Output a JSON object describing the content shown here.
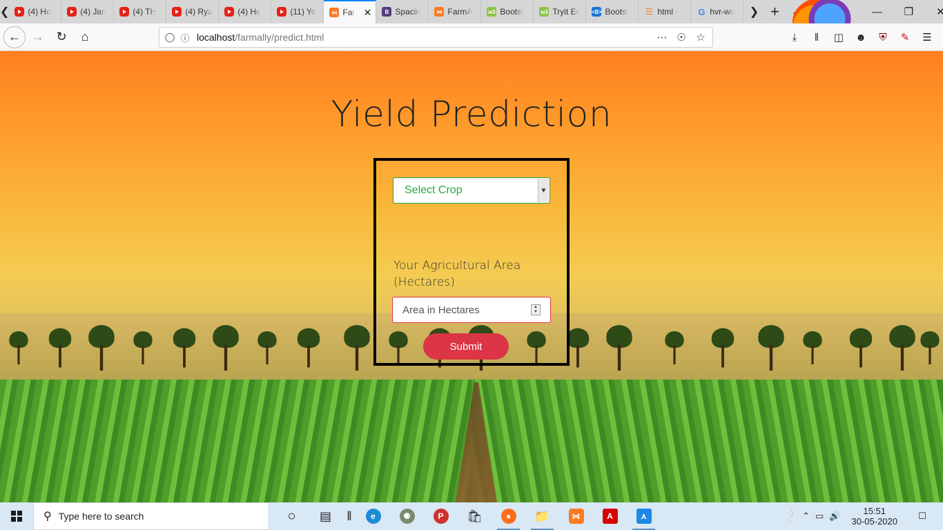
{
  "browser": {
    "tabs": [
      {
        "label": "(4) Ho",
        "icon": "youtube-icon",
        "active": false
      },
      {
        "label": "(4) Jan",
        "icon": "youtube-icon",
        "active": false
      },
      {
        "label": "(4) TH",
        "icon": "youtube-icon",
        "active": false
      },
      {
        "label": "(4) Rya",
        "icon": "youtube-icon",
        "active": false
      },
      {
        "label": "(4) Ho",
        "icon": "youtube-icon",
        "active": false
      },
      {
        "label": "(11) Yo",
        "icon": "youtube-icon",
        "active": false
      },
      {
        "label": "Far",
        "icon": "xampp-icon",
        "active": true
      },
      {
        "label": "Spacin",
        "icon": "bootstrap-icon",
        "active": false
      },
      {
        "label": "FarmA",
        "icon": "xampp-icon",
        "active": false
      },
      {
        "label": "Bootst",
        "icon": "w3schools-icon",
        "active": false
      },
      {
        "label": "Tryit Ec",
        "icon": "w3schools-icon",
        "active": false
      },
      {
        "label": "Bootst",
        "icon": "bootstrap-b-icon",
        "active": false
      },
      {
        "label": "html -",
        "icon": "stackoverflow-icon",
        "active": false
      },
      {
        "label": "hvr-wo",
        "icon": "google-icon",
        "active": false
      }
    ],
    "url": {
      "host": "localhost",
      "path": "/farmally/predict.html"
    }
  },
  "page": {
    "heading": "Yield Prediction",
    "crop_select": {
      "selected": "Select Crop"
    },
    "area_label": "Your Agricultural Area (Hectares)",
    "area_input": {
      "placeholder": "Area in Hectares"
    },
    "submit_label": "Submit"
  },
  "taskbar": {
    "search_placeholder": "Type here to search",
    "time": "15:51",
    "date": "30-05-2020"
  },
  "colors": {
    "accent_green": "#28a745",
    "accent_red": "#dc3545",
    "tab_highlight": "#0a84ff"
  }
}
